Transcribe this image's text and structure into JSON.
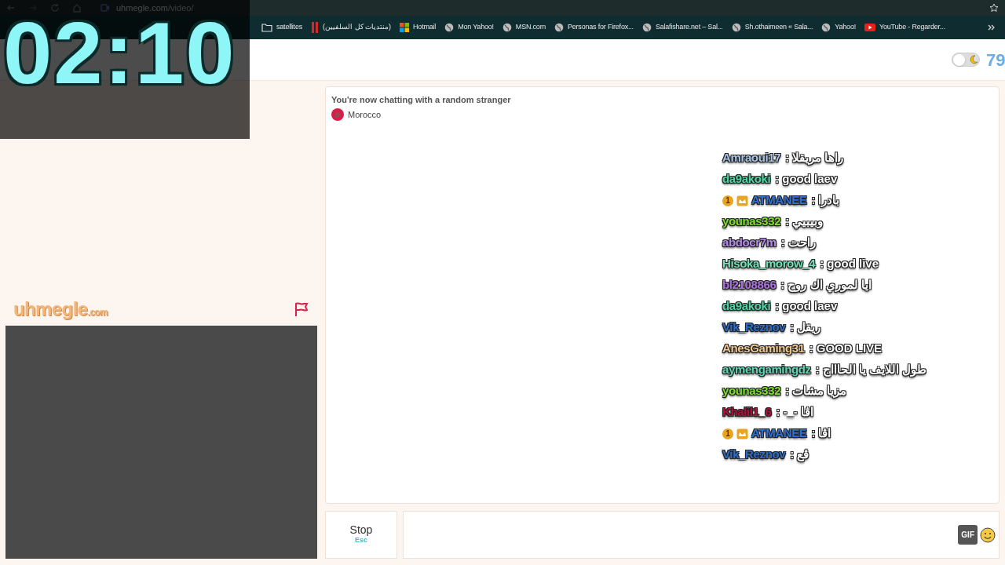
{
  "browser": {
    "url": "uhmegle.com",
    "url_path": "/video/",
    "bookmarks": [
      {
        "kind": "folder",
        "label": "satellites"
      },
      {
        "kind": "bars",
        "label": "(منتديات كل السلفيين)"
      },
      {
        "kind": "windows",
        "label": "Hotmail"
      },
      {
        "kind": "globe",
        "label": "Mon Yahoo!"
      },
      {
        "kind": "globe",
        "label": "MSN.com"
      },
      {
        "kind": "globe",
        "label": "Personas for Firefox..."
      },
      {
        "kind": "globe",
        "label": "Salafishare.net – Sal..."
      },
      {
        "kind": "globe",
        "label": "Sh.othaimeen « Sala..."
      },
      {
        "kind": "globe",
        "label": "Yahoo!"
      },
      {
        "kind": "youtube",
        "label": "YouTube - Regarder..."
      }
    ]
  },
  "timer": "02:10",
  "header": {
    "dark_mode": {
      "on": false
    },
    "count": "79"
  },
  "logo": {
    "name": "uhmegle",
    "suffix": ".com"
  },
  "chat": {
    "status": "You're now chatting with a random stranger",
    "country": "Morocco"
  },
  "stream_chat": [
    {
      "user": "Amraoui17",
      "color": "#aac4e6",
      "separator": ":",
      "message": "راها مريقلا"
    },
    {
      "user": "da9akoki",
      "color": "#4cd6a4",
      "separator": ":",
      "message": "good laev"
    },
    {
      "user": "ATMANEE",
      "color": "#2e6fd8",
      "separator": ":",
      "message": "بادرا",
      "badge": "1",
      "crown": true
    },
    {
      "user": "younas332",
      "color": "#7ddf28",
      "separator": ":",
      "message": "وبيبيي"
    },
    {
      "user": "abdocr7m",
      "color": "#b48ae6",
      "separator": ":",
      "message": "راحت"
    },
    {
      "user": "Hisoka_morow_4",
      "color": "#74e0b8",
      "separator": ":",
      "message": "good live"
    },
    {
      "user": "bl2108866",
      "color": "#ae70e0",
      "separator": ":",
      "message": "ايا لموري اك روح"
    },
    {
      "user": "da9akoki",
      "color": "#4cd6a4",
      "separator": ":",
      "message": "good laev"
    },
    {
      "user": "Vik_Reznov",
      "color": "#2a6cc8",
      "separator": ":",
      "message": "ريقل"
    },
    {
      "user": "AnesGaming31",
      "color": "#f0c890",
      "separator": ":",
      "message": "GOOD LIVE"
    },
    {
      "user": "aymengamingdz",
      "color": "#5cd6b0",
      "separator": ":",
      "message": "طول اللايف يا الحاااج"
    },
    {
      "user": "younas332",
      "color": "#7ddf28",
      "separator": ":",
      "message": "مزيا مشات"
    },
    {
      "user": "Khalil1_6",
      "color": "#b0103a",
      "separator": ":",
      "message": "-_- اڤا"
    },
    {
      "user": "ATMANEE",
      "color": "#2e6fd8",
      "separator": ":",
      "message": "اڤا",
      "badge": "1",
      "crown": true
    },
    {
      "user": "Vik_Reznov",
      "color": "#2a6cc8",
      "separator": ":",
      "message": "ڤع"
    }
  ],
  "controls": {
    "stop": "Stop",
    "stop_key": "Esc",
    "gif": "GIF"
  }
}
